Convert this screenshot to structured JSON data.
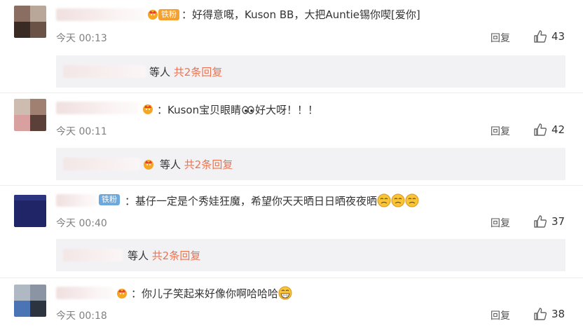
{
  "comments": [
    {
      "badge": "铁粉",
      "text": "：好得意嘅，Kuson BB，大把Auntie锡你喫[爱你]",
      "time": "今天 00:13",
      "reply": "回复",
      "likes": "43",
      "sub": {
        "prefix": "等人",
        "link": "共2条回复"
      }
    },
    {
      "badge": "",
      "text_a": "：Kuson宝贝眼睛",
      "text_b": "好大呀！！！",
      "time": "今天 00:11",
      "reply": "回复",
      "likes": "42",
      "sub": {
        "prefix": "等人",
        "link": "共2条回复"
      }
    },
    {
      "badge": "铁粉",
      "text": "：基仔一定是个秀娃狂魔，希望你天天晒日日晒夜夜晒",
      "time": "今天 00:40",
      "reply": "回复",
      "likes": "37",
      "sub": {
        "prefix": "等人",
        "link": "共2条回复"
      }
    },
    {
      "badge": "",
      "text": "：你儿子笑起来好像你啊哈哈哈",
      "time": "今天 00:18",
      "reply": "回复",
      "likes": "38"
    }
  ],
  "colors": {
    "link": "#eb7350",
    "tie_badge": "#f4a12f",
    "tie_badge_blue": "#6fa8dc",
    "sub_bg": "#f2f2f5"
  }
}
